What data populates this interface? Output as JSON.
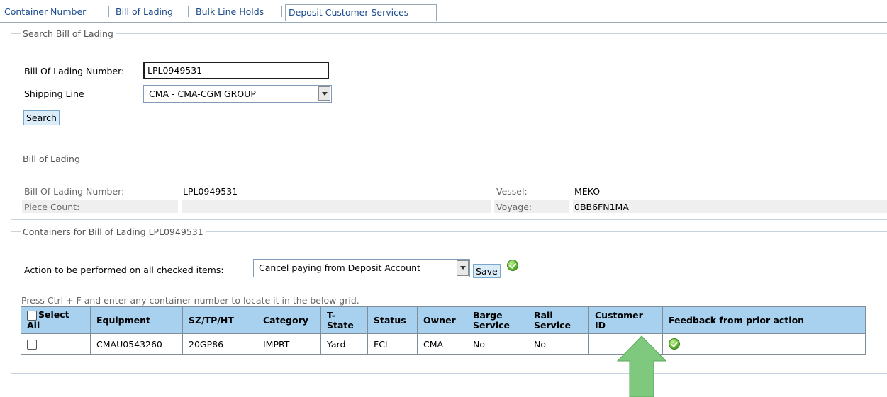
{
  "tabs": [
    "Container Number",
    "Bill of Lading",
    "Bulk Line Holds",
    "Deposit Customer Services"
  ],
  "search": {
    "legend": "Search Bill of Lading",
    "bol_label": "Bill Of Lading Number:",
    "bol_value": "LPL0949531",
    "line_label": "Shipping Line",
    "line_value": "CMA - CMA-CGM GROUP",
    "search_button": "Search"
  },
  "bol": {
    "legend": "Bill of Lading",
    "bol_label": "Bill Of Lading Number:",
    "bol_value": "LPL0949531",
    "piece_label": "Piece Count:",
    "piece_value": "",
    "vessel_label": "Vessel:",
    "vessel_value": "MEKO",
    "voyage_label": "Voyage:",
    "voyage_value": "0BB6FN1MA"
  },
  "containers": {
    "legend": "Containers for Bill of Lading LPL0949531",
    "action_label": "Action to be performed on all checked items:",
    "action_value": "Cancel paying from Deposit Account",
    "save_button": "Save",
    "hint": "Press Ctrl + F and enter any container number to locate it in the below grid.",
    "headers": {
      "select_all": "Select All",
      "equipment": "Equipment",
      "sz": "SZ/TP/HT",
      "category": "Category",
      "tstate": "T-State",
      "status": "Status",
      "owner": "Owner",
      "barge": "Barge Service",
      "rail": "Rail Service",
      "customer": "Customer ID",
      "feedback": "Feedback from prior action"
    },
    "rows": [
      {
        "equipment": "CMAU0543260",
        "sz": "20GP86",
        "category": "IMPRT",
        "tstate": "Yard",
        "status": "FCL",
        "owner": "CMA",
        "barge": "No",
        "rail": "No",
        "customer": ""
      }
    ]
  },
  "colors": {
    "tab_link": "#1a4b8c",
    "grid_header": "#a7d1ee",
    "arrow": "#7fc97f"
  }
}
